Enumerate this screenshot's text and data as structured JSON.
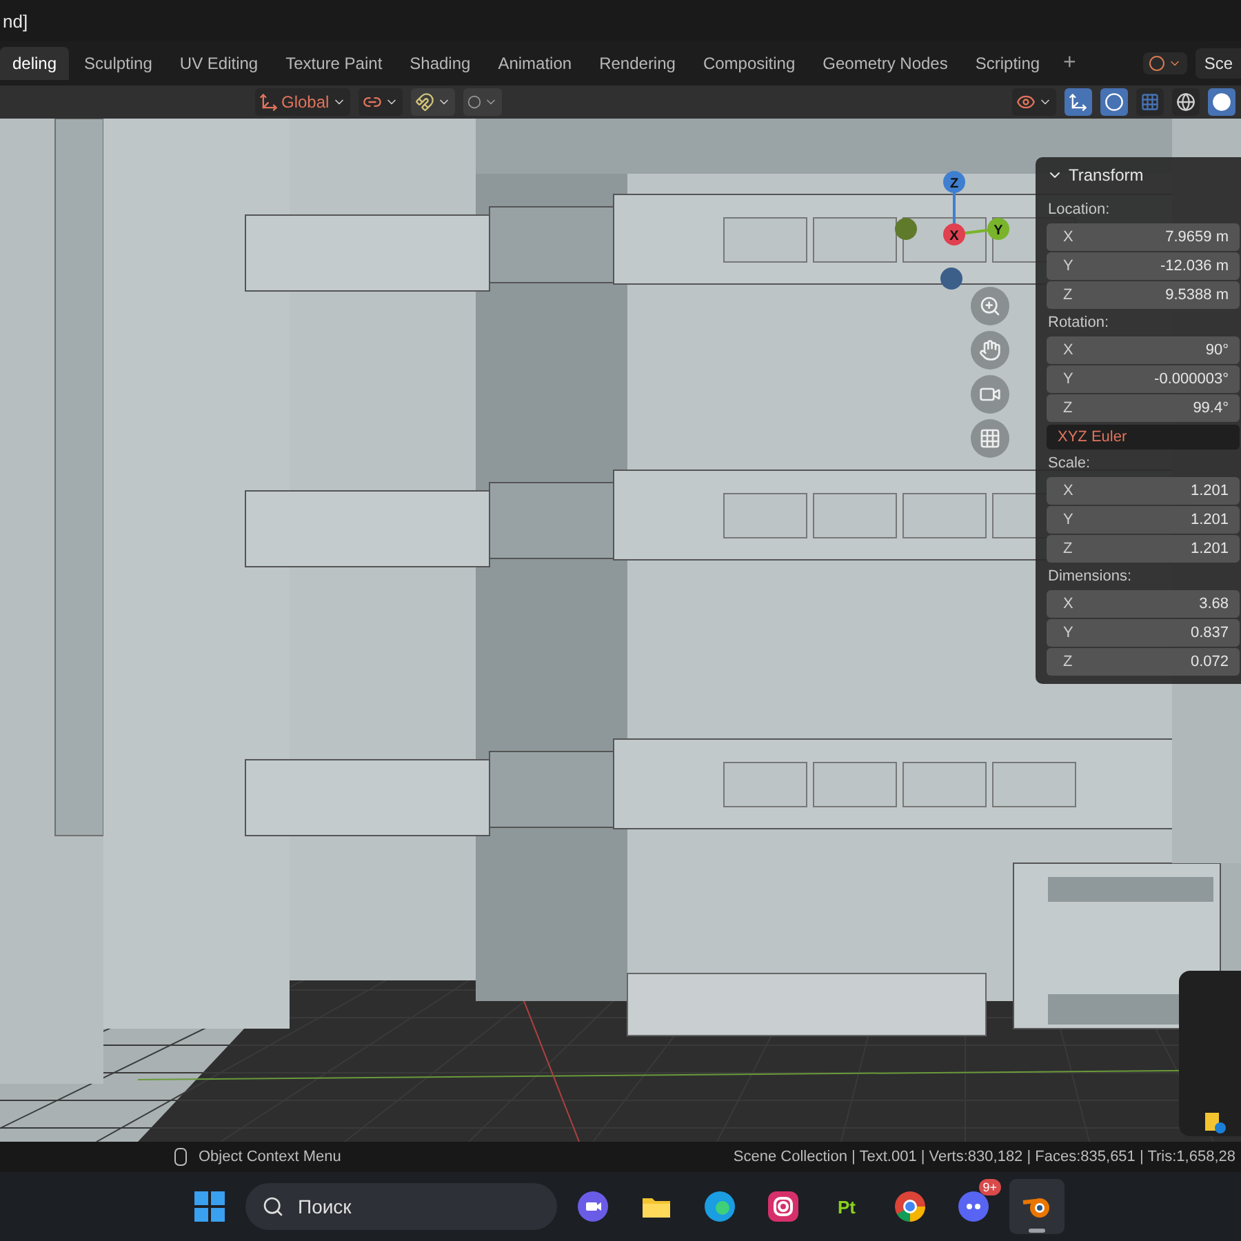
{
  "window": {
    "title": "nd]"
  },
  "workspace_tabs": [
    {
      "label": "deling",
      "selected": true
    },
    {
      "label": "Sculpting",
      "selected": false
    },
    {
      "label": "UV Editing",
      "selected": false
    },
    {
      "label": "Texture Paint",
      "selected": false
    },
    {
      "label": "Shading",
      "selected": false
    },
    {
      "label": "Animation",
      "selected": false
    },
    {
      "label": "Rendering",
      "selected": false
    },
    {
      "label": "Compositing",
      "selected": false
    },
    {
      "label": "Geometry Nodes",
      "selected": false
    },
    {
      "label": "Scripting",
      "selected": false
    }
  ],
  "add_tab": "+",
  "scene_field": "Sce",
  "header": {
    "orientation": "Global"
  },
  "gizmo": {
    "axes": [
      {
        "label": "Z",
        "color": "#3f7fd0"
      },
      {
        "label": "X",
        "color": "#e0404f"
      },
      {
        "label": "Y",
        "color": "#79b42a"
      }
    ]
  },
  "transform_panel": {
    "title": "Transform",
    "expanded": true,
    "sections": [
      {
        "label": "Location:",
        "fields": [
          {
            "axis": "X",
            "value": "7.9659 m"
          },
          {
            "axis": "Y",
            "value": "-12.036 m"
          },
          {
            "axis": "Z",
            "value": "9.5388 m"
          }
        ]
      },
      {
        "label": "Rotation:",
        "fields": [
          {
            "axis": "X",
            "value": "90°"
          },
          {
            "axis": "Y",
            "value": "-0.000003°"
          },
          {
            "axis": "Z",
            "value": "99.4°"
          }
        ],
        "mode": "XYZ Euler"
      },
      {
        "label": "Scale:",
        "fields": [
          {
            "axis": "X",
            "value": "1.201"
          },
          {
            "axis": "Y",
            "value": "1.201"
          },
          {
            "axis": "Z",
            "value": "1.201"
          }
        ]
      },
      {
        "label": "Dimensions:",
        "fields": [
          {
            "axis": "X",
            "value": "3.68"
          },
          {
            "axis": "Y",
            "value": "0.837"
          },
          {
            "axis": "Z",
            "value": "0.072"
          }
        ]
      }
    ]
  },
  "status_bar": {
    "hint": "Object Context Menu",
    "stats": "Scene Collection | Text.001 | Verts:830,182 | Faces:835,651 | Tris:1,658,28"
  },
  "taskbar": {
    "search_placeholder": "Поиск",
    "apps": [
      {
        "kind": "meet",
        "active": false
      },
      {
        "kind": "folder",
        "active": false
      },
      {
        "kind": "browser",
        "active": false
      },
      {
        "kind": "camera",
        "active": false
      },
      {
        "kind": "pt",
        "label": "Pt",
        "active": false
      },
      {
        "kind": "chrome",
        "active": false
      },
      {
        "kind": "chat",
        "badge": "9+",
        "active": false
      },
      {
        "kind": "blender",
        "active": true
      }
    ]
  }
}
